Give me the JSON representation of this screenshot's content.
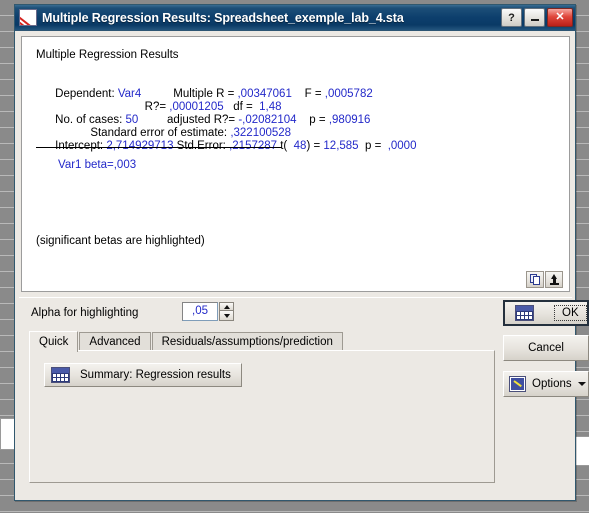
{
  "window": {
    "title": "Multiple Regression Results: Spreadsheet_exemple_lab_4.sta",
    "icon": "statistica-sheet-icon",
    "help_label": "?",
    "minimize_label": "–",
    "close_label": "✕"
  },
  "results": {
    "heading": "Multiple Regression Results",
    "lines": [
      {
        "segments": [
          {
            "text": "Dependent: ",
            "color": "black"
          },
          {
            "text": "Var4",
            "color": "blue"
          },
          {
            "text": "          Multiple R = ",
            "color": "black"
          },
          {
            "text": ",00347061",
            "color": "blue"
          },
          {
            "text": "    F = ",
            "color": "black"
          },
          {
            "text": ",0005782",
            "color": "blue"
          }
        ]
      },
      {
        "segments": [
          {
            "text": "                            R?= ",
            "color": "black"
          },
          {
            "text": ",00001205",
            "color": "blue"
          },
          {
            "text": "   df = ",
            "color": "black"
          },
          {
            "text": " 1,48",
            "color": "blue"
          }
        ]
      },
      {
        "segments": [
          {
            "text": "No. of cases: ",
            "color": "black"
          },
          {
            "text": "50",
            "color": "blue"
          },
          {
            "text": "         adjusted R?= ",
            "color": "black"
          },
          {
            "text": "-,02082104",
            "color": "blue"
          },
          {
            "text": "    p = ",
            "color": "black"
          },
          {
            "text": ",980916",
            "color": "blue"
          }
        ]
      },
      {
        "segments": [
          {
            "text": "           Standard error of estimate: ",
            "color": "black"
          },
          {
            "text": ",322100528",
            "color": "blue"
          }
        ]
      },
      {
        "segments": [
          {
            "text": "Intercept: ",
            "color": "black"
          },
          {
            "text": "2,714929713",
            "color": "blue"
          },
          {
            "text": " Std.Error: ",
            "color": "black"
          },
          {
            "text": ",2157287",
            "color": "blue"
          },
          {
            "text": " t( ",
            "color": "black"
          },
          {
            "text": " 48",
            "color": "blue"
          },
          {
            "text": ") = ",
            "color": "black"
          },
          {
            "text": "12,585",
            "color": "blue"
          },
          {
            "text": "  p = ",
            "color": "black"
          },
          {
            "text": " ,0000",
            "color": "blue"
          }
        ]
      }
    ],
    "beta_line": "Var1 beta=,003",
    "footnote": "(significant betas are highlighted)",
    "copy_button": "copy-icon",
    "scroll_up_button": "up-arrow-icon"
  },
  "controls": {
    "alpha_label": "Alpha for highlighting",
    "alpha_value": ",05",
    "tabs": [
      {
        "label": "Quick",
        "active": true
      },
      {
        "label": "Advanced",
        "active": false
      },
      {
        "label": "Residuals/assumptions/prediction",
        "active": false
      }
    ],
    "summary_button": "Summary:  Regression results",
    "ok_label": "OK",
    "cancel_label": "Cancel",
    "options_label": "Options"
  },
  "colors": {
    "value_blue": "#2329c9",
    "titlebar_blue": "#0a3a66",
    "dialog_face": "#ece9e4",
    "close_red": "#e0473c"
  }
}
